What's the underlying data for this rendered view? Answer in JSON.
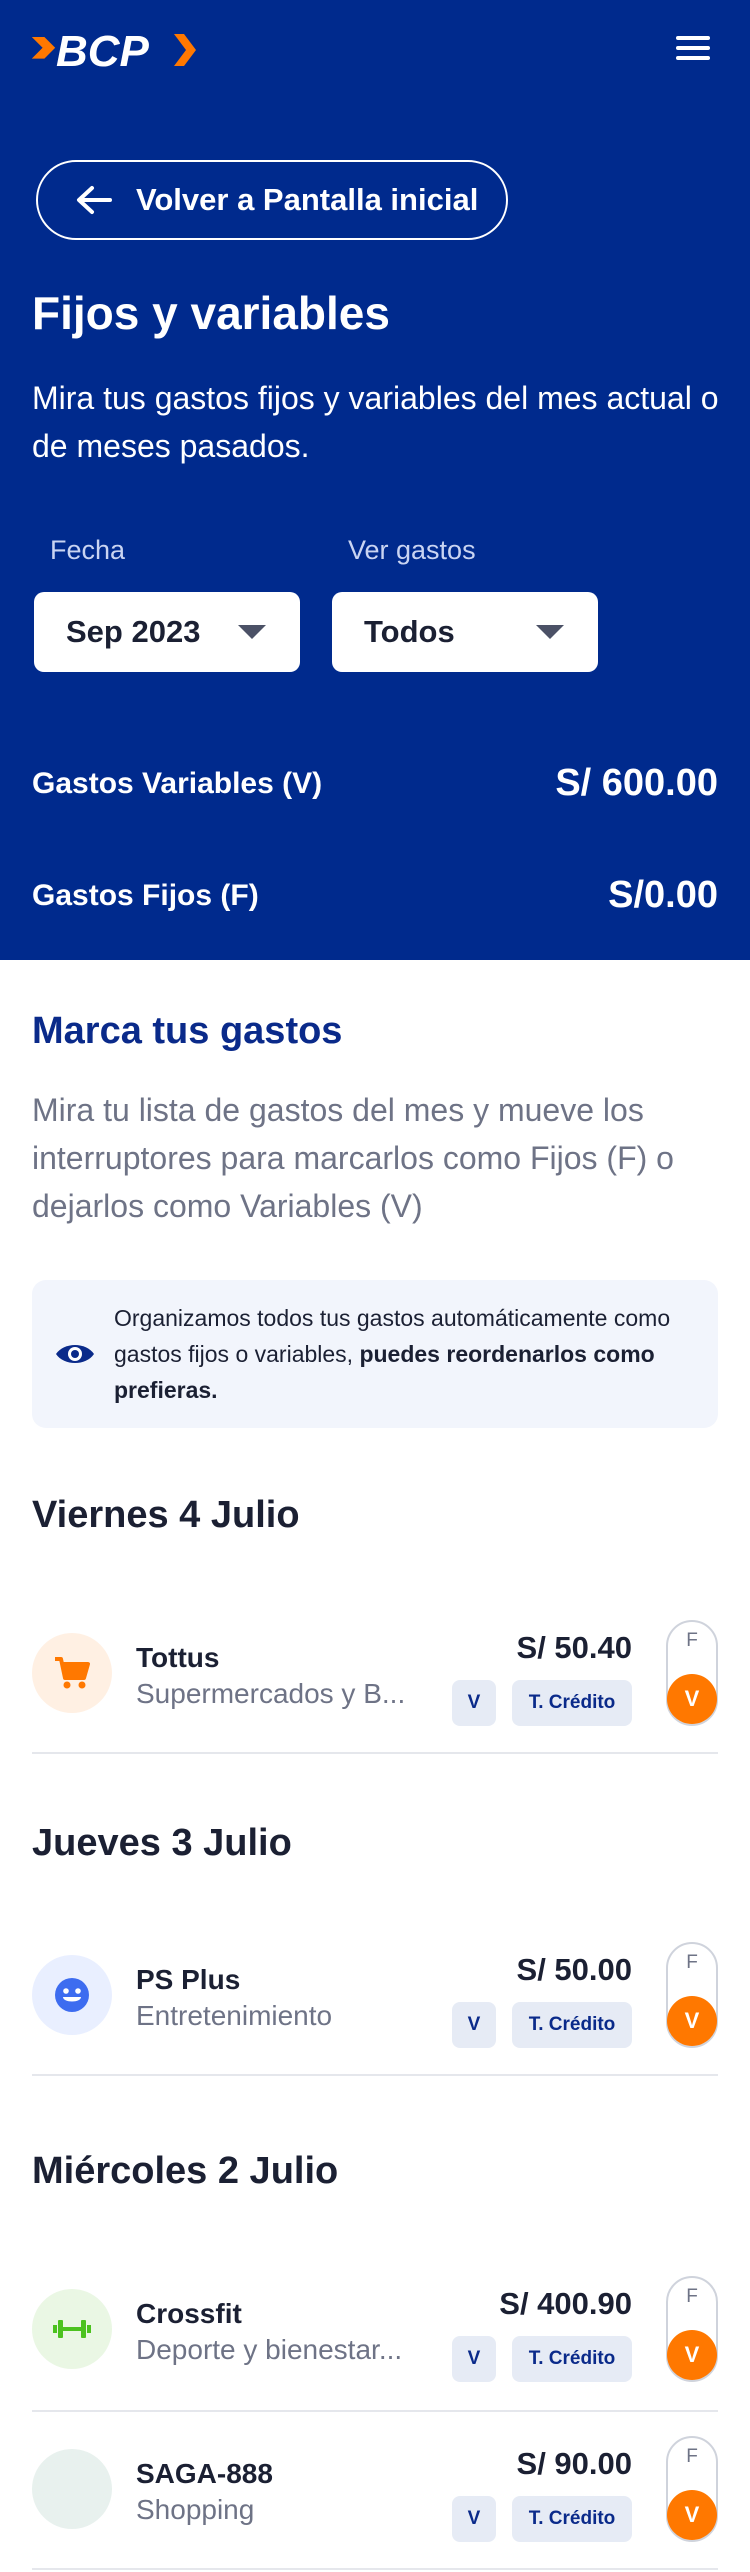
{
  "header": {
    "logo_text": "BCP",
    "menu_icon": "hamburger-icon"
  },
  "hero": {
    "back_label": "Volver a Pantalla inicial",
    "title": "Fijos y variables",
    "subtitle": "Mira tus gastos fijos y variables del mes actual o de meses pasados.",
    "filters": {
      "date_label": "Fecha",
      "date_value": "Sep 2023",
      "spend_label": "Ver gastos",
      "spend_value": "Todos"
    },
    "summary": {
      "variable_label": "Gastos Variables (V)",
      "variable_value": "S/ 600.00",
      "fixed_label": "Gastos Fijos (F)",
      "fixed_value": "S/0.00"
    },
    "colors": {
      "brand_blue": "#002A8D",
      "accent_orange": "#FF7800"
    }
  },
  "section": {
    "title": "Marca tus gastos",
    "description": "Mira tu lista de gastos del mes y mueve los interruptores para marcarlos como Fijos (F) o dejarlos como Variables (V)",
    "info_text_normal": "Organizamos todos tus gastos automáticamente como gastos fijos o variables, ",
    "info_text_bold": "puedes reordenarlos como prefieras."
  },
  "days": [
    {
      "title": "Viernes 4 Julio",
      "transactions": [
        {
          "name": "Tottus",
          "category": "Supermercados y B...",
          "amount": "S/ 50.40",
          "type_badge": "V",
          "card_badge": "T. Crédito",
          "toggle_f": "F",
          "toggle_v": "V",
          "icon": "cart-icon"
        }
      ]
    },
    {
      "title": "Jueves 3 Julio",
      "transactions": [
        {
          "name": "PS Plus",
          "category": "Entretenimiento",
          "amount": "S/ 50.00",
          "type_badge": "V",
          "card_badge": "T. Crédito",
          "toggle_f": "F",
          "toggle_v": "V",
          "icon": "smiley-icon"
        }
      ]
    },
    {
      "title": "Miércoles 2 Julio",
      "transactions": [
        {
          "name": "Crossfit",
          "category": "Deporte y bienestar...",
          "amount": "S/ 400.90",
          "type_badge": "V",
          "card_badge": "T. Crédito",
          "toggle_f": "F",
          "toggle_v": "V",
          "icon": "dumbbell-icon"
        },
        {
          "name": "SAGA-888",
          "category": "Shopping",
          "amount": "S/ 90.00",
          "type_badge": "V",
          "card_badge": "T. Crédito",
          "toggle_f": "F",
          "toggle_v": "V",
          "icon": "shopping-icon"
        }
      ]
    }
  ]
}
